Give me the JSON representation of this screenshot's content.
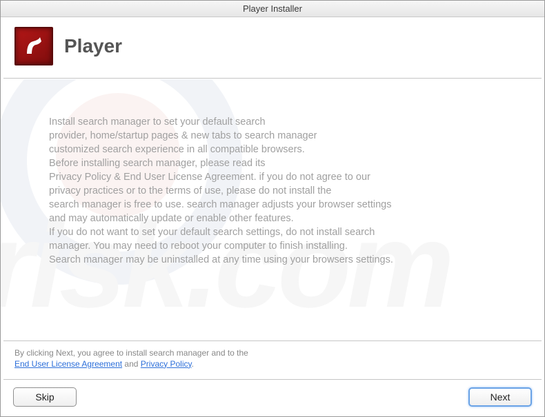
{
  "window": {
    "title": "Player Installer"
  },
  "header": {
    "app_name": "Player"
  },
  "body": {
    "text": "Install search manager to set your default search\nprovider, home/startup pages & new tabs to search manager\ncustomized search experience in all compatible browsers.\nBefore installing search manager, please read its\nPrivacy Policy & End User License Agreement. if you do not agree to our\nprivacy practices or to the terms of use, please do not install the\nsearch manager is free to use. search manager adjusts your browser settings\nand may automatically update or enable other features.\nIf you do not want to set your default search settings, do not install search\nmanager. You may need to reboot your computer to finish installing.\nSearch manager may be uninstalled at any time using your browsers settings."
  },
  "footer": {
    "disclaimer_prefix": "By clicking Next, you agree to install search manager and to the",
    "eula_link": "End User License Agreement",
    "and": " and ",
    "privacy_link": "Privacy Policy",
    "period": "."
  },
  "buttons": {
    "skip": "Skip",
    "next": "Next"
  }
}
